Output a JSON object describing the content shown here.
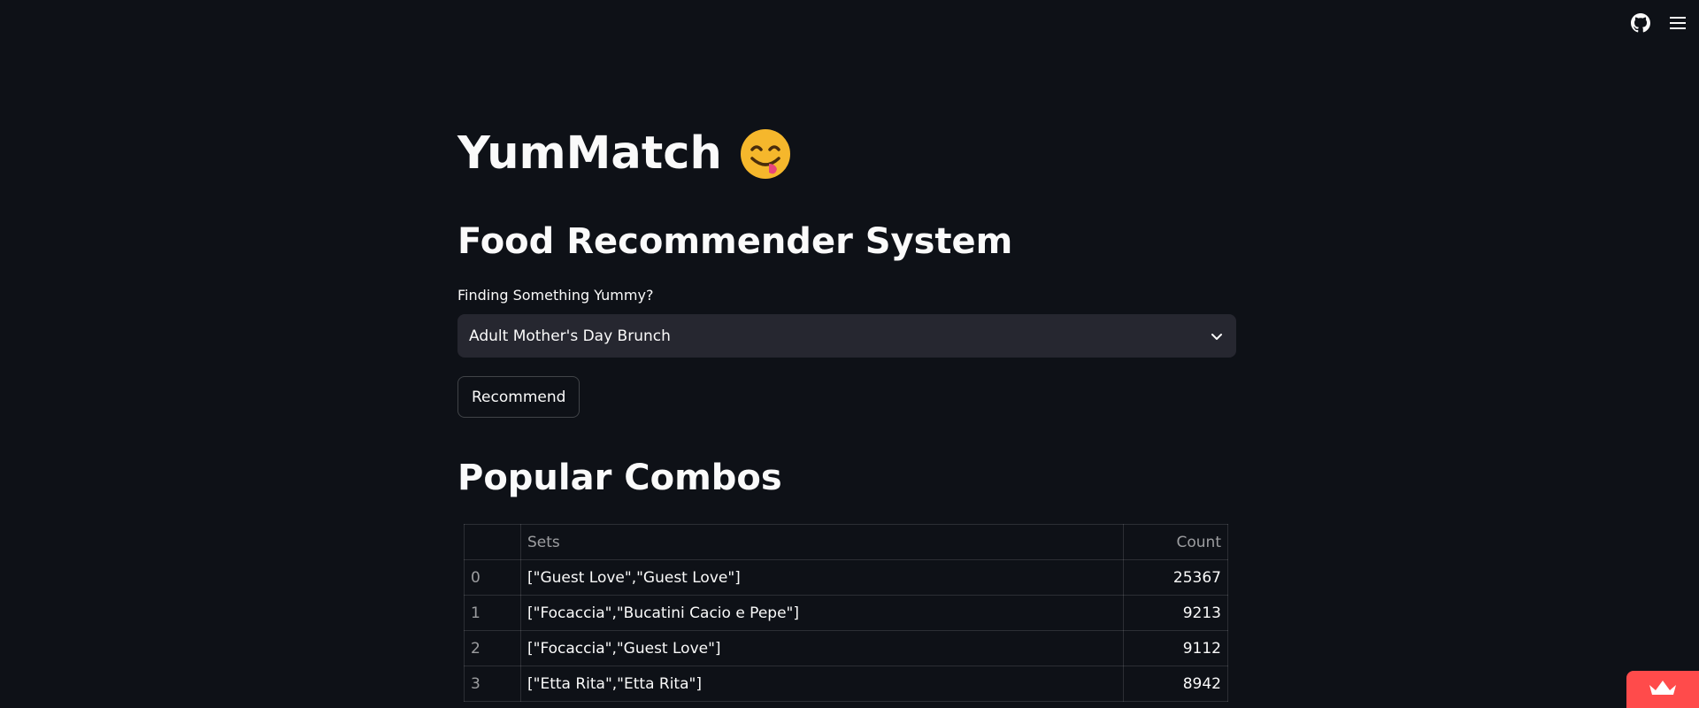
{
  "toolbar": {
    "icons": [
      "github-icon",
      "hamburger-menu-icon"
    ]
  },
  "header": {
    "title": "YumMatch",
    "emoji_icon": "face-savoring-food-icon",
    "subtitle": "Food Recommender System"
  },
  "selector": {
    "label": "Finding Something Yummy?",
    "value": "Adult Mother's Day Brunch"
  },
  "actions": {
    "recommend_label": "Recommend"
  },
  "combos": {
    "title": "Popular Combos",
    "columns": [
      "",
      "Sets",
      "Count"
    ],
    "rows": [
      {
        "index": "0",
        "sets": "[\"Guest Love\",\"Guest Love\"]",
        "count": "25367"
      },
      {
        "index": "1",
        "sets": "[\"Focaccia\",\"Bucatini Cacio e Pepe\"]",
        "count": "9213"
      },
      {
        "index": "2",
        "sets": "[\"Focaccia\",\"Guest Love\"]",
        "count": "9112"
      },
      {
        "index": "3",
        "sets": "[\"Etta Rita\",\"Etta Rita\"]",
        "count": "8942"
      }
    ]
  },
  "colors": {
    "background": "#0e1117",
    "input_bg": "#262730",
    "accent": "#ff4b4b",
    "text": "#fafafa"
  },
  "badge": {
    "icon": "crown-icon"
  }
}
